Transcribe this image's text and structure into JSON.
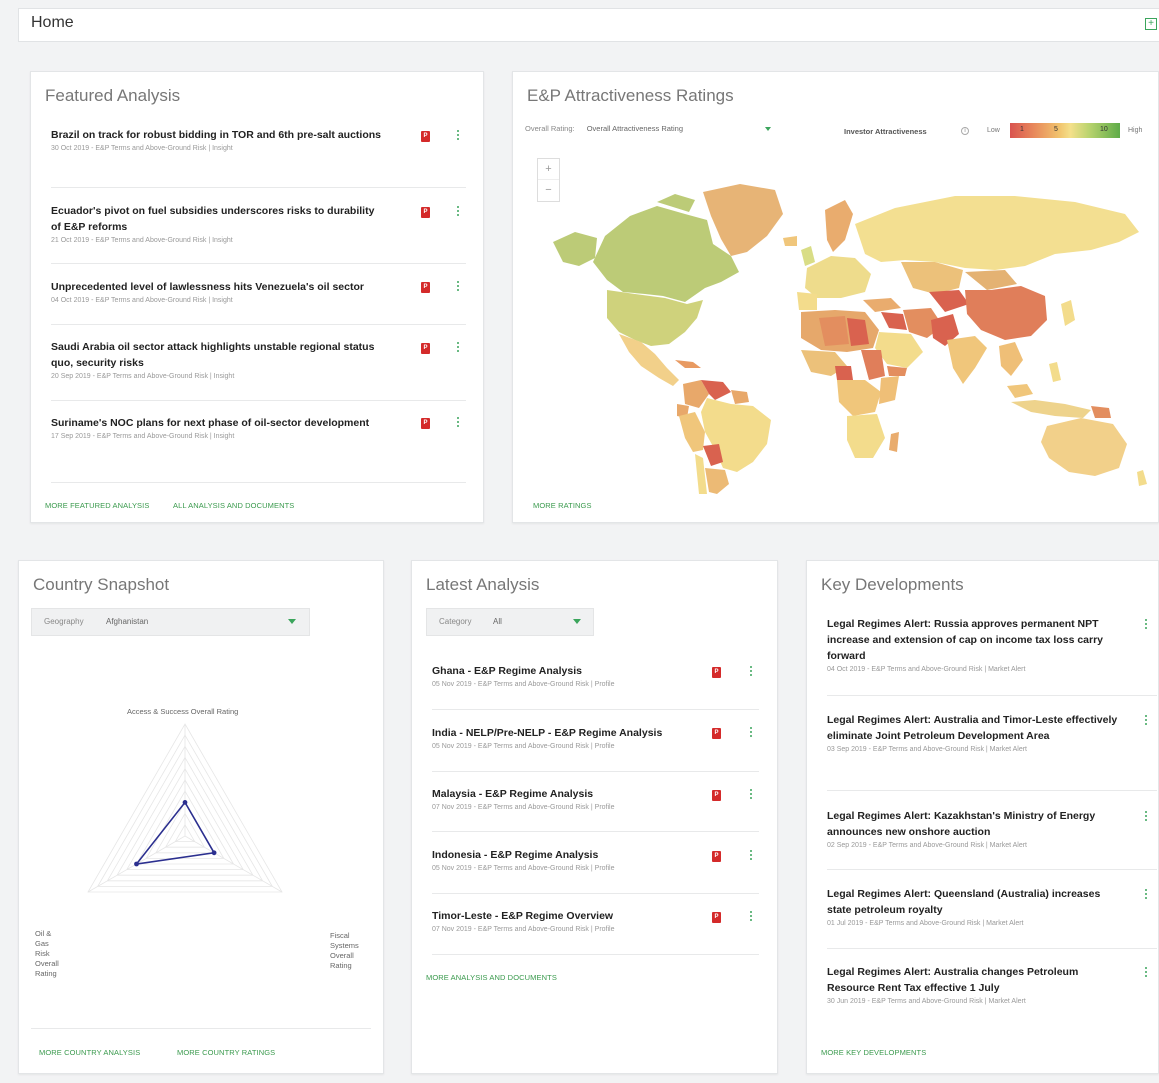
{
  "header": {
    "title": "Home",
    "expand_icon": "expand-icon"
  },
  "featured": {
    "title": "Featured Analysis",
    "items": [
      {
        "title": "Brazil on track for robust bidding in TOR and 6th pre-salt auctions",
        "meta": "30 Oct 2019 - E&P Terms and Above-Ground Risk | Insight"
      },
      {
        "title": "Ecuador's pivot on fuel subsidies underscores risks to durability of E&P reforms",
        "meta": "21 Oct 2019 - E&P Terms and Above-Ground Risk | Insight"
      },
      {
        "title": "Unprecedented level of lawlessness hits Venezuela's oil sector",
        "meta": "04 Oct 2019 - E&P Terms and Above-Ground Risk | Insight"
      },
      {
        "title": "Saudi Arabia oil sector attack highlights unstable regional status quo, security risks",
        "meta": "20 Sep 2019 - E&P Terms and Above-Ground Risk | Insight"
      },
      {
        "title": "Suriname's NOC plans for next phase of oil-sector development",
        "meta": "17 Sep 2019 - E&P Terms and Above-Ground Risk | Insight"
      }
    ],
    "link_more": "More featured analysis",
    "link_all": "All analysis and documents"
  },
  "ratings": {
    "title": "E&P Attractiveness Ratings",
    "select_label": "Overall Rating",
    "select_value": "Overall Attractiveness Rating",
    "legend_title": "Investor Attractiveness",
    "legend_low": "Low",
    "legend_high": "High",
    "legend_ticks": [
      "1",
      "5",
      "10"
    ],
    "zoom_in": "+",
    "zoom_out": "−",
    "link_more": "More ratings"
  },
  "snapshot": {
    "title": "Country Snapshot",
    "select_label": "Geography",
    "select_value": "Afghanistan",
    "axis_top": "Access & Success Overall Rating",
    "axis_left": "Oil & Gas Risk Overall Rating",
    "axis_right": "Fiscal Systems Overall Rating",
    "radar_values": [
      3,
      3,
      5
    ],
    "radar_max": 10,
    "link_analysis": "More country analysis",
    "link_ratings": "More country ratings"
  },
  "latest": {
    "title": "Latest Analysis",
    "select_label": "Category",
    "select_value": "All",
    "items": [
      {
        "title": "Ghana - E&P Regime Analysis",
        "meta": "05 Nov 2019 - E&P Terms and Above-Ground Risk | Profile"
      },
      {
        "title": "India - NELP/Pre-NELP - E&P Regime Analysis",
        "meta": "05 Nov 2019 - E&P Terms and Above-Ground Risk | Profile"
      },
      {
        "title": "Malaysia - E&P Regime Analysis",
        "meta": "07 Nov 2019 - E&P Terms and Above-Ground Risk | Profile"
      },
      {
        "title": "Indonesia - E&P Regime Analysis",
        "meta": "05 Nov 2019 - E&P Terms and Above-Ground Risk | Profile"
      },
      {
        "title": "Timor-Leste - E&P Regime Overview",
        "meta": "07 Nov 2019 - E&P Terms and Above-Ground Risk | Profile"
      }
    ],
    "link_more": "More analysis and documents"
  },
  "developments": {
    "title": "Key Developments",
    "items": [
      {
        "title": "Legal Regimes Alert: Russia approves permanent NPT increase and extension of cap on income tax loss carry forward",
        "meta": "04 Oct 2019 - E&P Terms and Above-Ground Risk | Market Alert"
      },
      {
        "title": "Legal Regimes Alert: Australia and Timor-Leste effectively eliminate Joint Petroleum Development Area",
        "meta": "03 Sep 2019 - E&P Terms and Above-Ground Risk | Market Alert"
      },
      {
        "title": "Legal Regimes Alert: Kazakhstan's Ministry of Energy announces new onshore auction",
        "meta": "02 Sep 2019 - E&P Terms and Above-Ground Risk | Market Alert"
      },
      {
        "title": "Legal Regimes Alert: Queensland (Australia) increases state petroleum royalty",
        "meta": "01 Jul 2019 - E&P Terms and Above-Ground Risk | Market Alert"
      },
      {
        "title": "Legal Regimes Alert: Australia changes Petroleum Resource Rent Tax effective 1 July",
        "meta": "30 Jun 2019 - E&P Terms and Above-Ground Risk | Market Alert"
      }
    ],
    "link_more": "More key developments"
  },
  "colors": {
    "accent": "#3ba55c",
    "pdf": "#d42a2a",
    "radar": "#2b2f8f"
  }
}
